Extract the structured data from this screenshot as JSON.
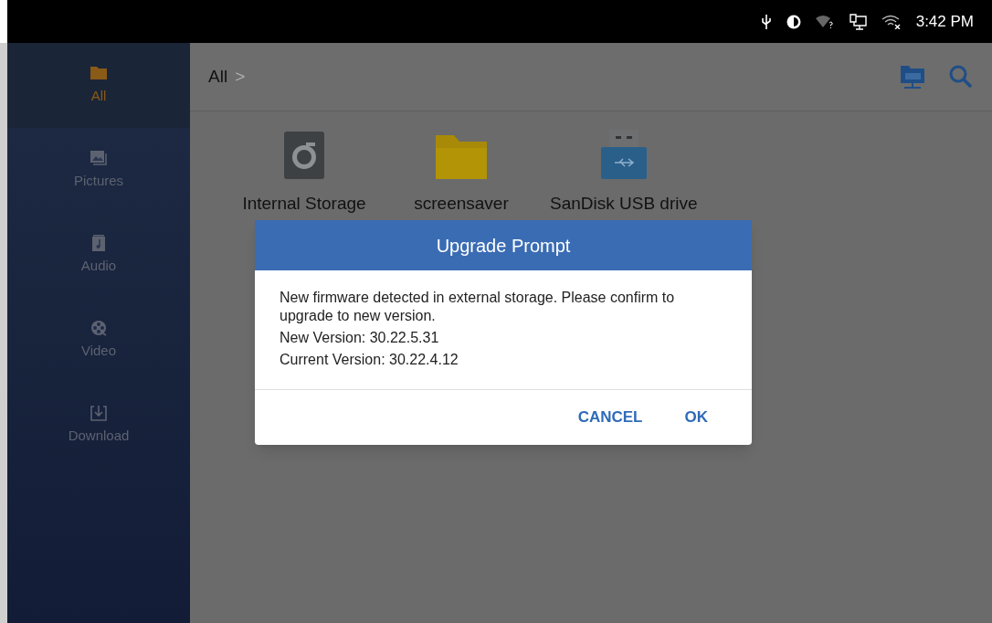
{
  "status_bar": {
    "time": "3:42 PM"
  },
  "sidebar": {
    "items": [
      {
        "label": "All",
        "kind": "folder",
        "selected": true
      },
      {
        "label": "Pictures",
        "kind": "pictures",
        "selected": false
      },
      {
        "label": "Audio",
        "kind": "audio",
        "selected": false
      },
      {
        "label": "Video",
        "kind": "video",
        "selected": false
      },
      {
        "label": "Download",
        "kind": "download",
        "selected": false
      }
    ]
  },
  "breadcrumb": {
    "path": "All",
    "separator": ">"
  },
  "files": [
    {
      "name": "Internal Storage",
      "kind": "disk"
    },
    {
      "name": "screensaver",
      "kind": "folder"
    },
    {
      "name": "SanDisk USB drive",
      "kind": "usb"
    }
  ],
  "dialog": {
    "title": "Upgrade Prompt",
    "message": "New firmware detected in external storage. Please confirm to upgrade to new version.",
    "lines": [
      "New Version: 30.22.5.31",
      "Current Version: 30.22.4.12"
    ],
    "buttons": [
      "CANCEL",
      "OK"
    ]
  }
}
